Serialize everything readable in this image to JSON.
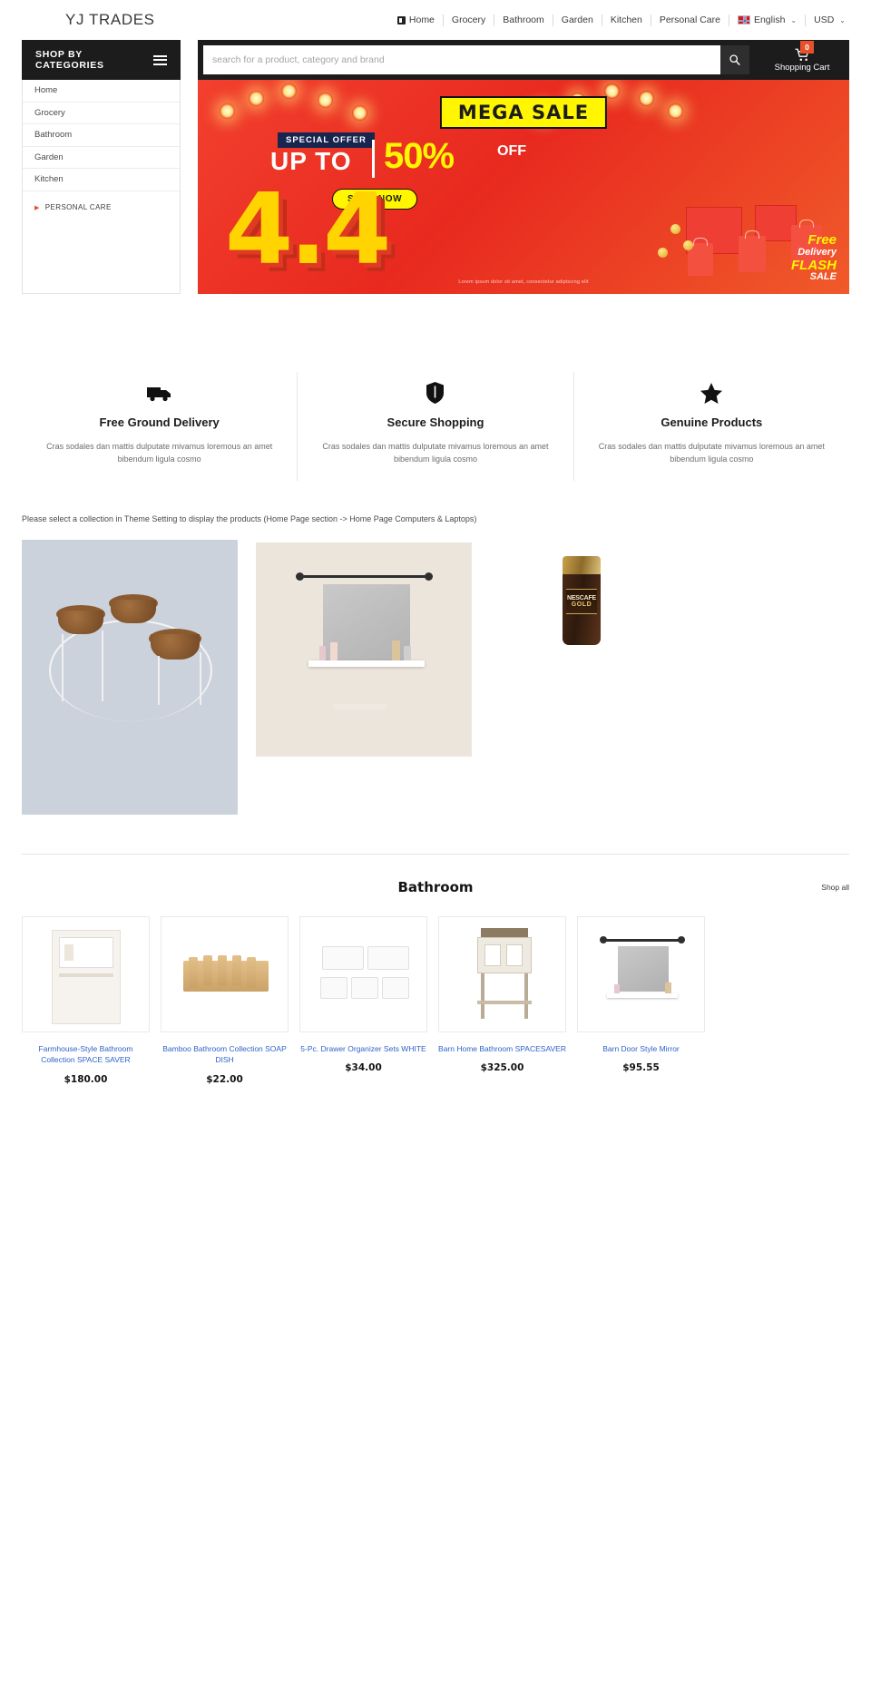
{
  "brand": {
    "logo": "YJ TRADES"
  },
  "topnav": {
    "items": [
      {
        "label": "Home",
        "icon": "home-icon"
      },
      {
        "label": "Grocery"
      },
      {
        "label": "Bathroom"
      },
      {
        "label": "Garden"
      },
      {
        "label": "Kitchen"
      },
      {
        "label": "Personal Care"
      }
    ],
    "language": {
      "label": "English",
      "icon": "uk-flag-icon",
      "caret": "⌄"
    },
    "currency": {
      "label": "USD",
      "caret": "⌄"
    }
  },
  "header": {
    "categories_title": "SHOP BY CATEGORIES",
    "search": {
      "placeholder": "search for a product, category and brand",
      "value": "",
      "icon": "search-icon"
    },
    "cart": {
      "label": "Shopping Cart",
      "count": "0",
      "icon": "shopping-cart-icon",
      "badge_color": "#e8502a"
    }
  },
  "sidebar": {
    "items": [
      {
        "label": "Home"
      },
      {
        "label": "Grocery"
      },
      {
        "label": "Bathroom"
      },
      {
        "label": "Garden"
      },
      {
        "label": "Kitchen"
      }
    ],
    "expandable": {
      "label": "PERSONAL CARE",
      "icon": "caret-right-icon"
    }
  },
  "hero": {
    "title": "MEGA SALE",
    "special_offer": "SPECIAL OFFER",
    "up_to": "UP TO",
    "percent": "50%",
    "off": "OFF",
    "cta": "SHOP NOW",
    "big_number": "4.4",
    "free_line1": "Free",
    "free_line2": "Delivery",
    "flash_line1": "FLASH",
    "flash_line2": "SALE",
    "terms": "Lorem ipsum dolor sit amet, consectetur adipiscing elit",
    "bg_color": "#ef3124",
    "accent_color": "#ffd400"
  },
  "features": [
    {
      "icon": "delivery-truck-icon",
      "title": "Free Ground Delivery",
      "text": "Cras sodales dan mattis dulputate mivamus loremous an amet bibendum ligula cosmo"
    },
    {
      "icon": "shield-icon",
      "title": "Secure Shopping",
      "text": "Cras sodales dan mattis dulputate mivamus loremous an amet bibendum ligula cosmo"
    },
    {
      "icon": "star-icon",
      "title": "Genuine Products",
      "text": "Cras sodales dan mattis dulputate mivamus loremous an amet bibendum ligula cosmo"
    }
  ],
  "notice": "Please select a collection in Theme Setting to display the products (Home Page section -> Home Page Computers & Laptops)",
  "banners": [
    {
      "alt": "plant-stand-banner"
    },
    {
      "alt": "bathroom-mirror-shelf-banner"
    },
    {
      "alt": "nescafe-gold-coffee-jar-banner"
    }
  ],
  "section": {
    "title": "Bathroom",
    "shop_all": "Shop all"
  },
  "products": [
    {
      "title": "Farmhouse-Style Bathroom Collection SPACE SAVER",
      "price": "$180.00",
      "thumb": "white-bathroom-cabinet"
    },
    {
      "title": "Bamboo Bathroom Collection SOAP DISH",
      "price": "$22.00",
      "thumb": "bamboo-soap-dish"
    },
    {
      "title": "5-Pc. Drawer Organizer Sets WHITE",
      "price": "$34.00",
      "thumb": "white-drawer-organizers"
    },
    {
      "title": "Barn Home Bathroom SPACESAVER",
      "price": "$325.00",
      "thumb": "barn-style-spacesaver"
    },
    {
      "title": "Barn Door Style Mirror",
      "price": "$95.55",
      "thumb": "barn-door-mirror"
    }
  ]
}
